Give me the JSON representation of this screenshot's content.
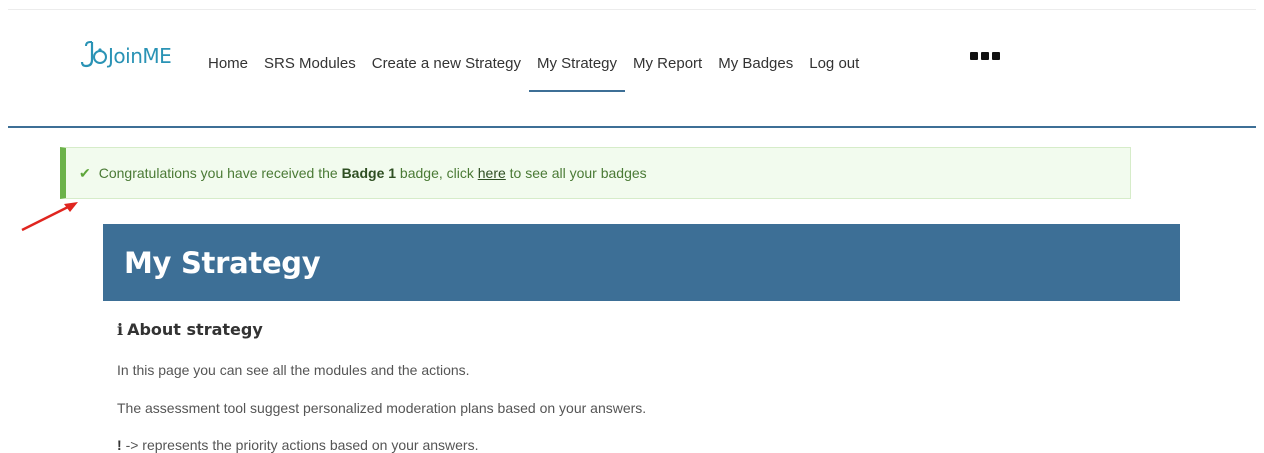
{
  "header": {
    "logo_text": "JoinME",
    "nav": [
      {
        "label": "Home"
      },
      {
        "label": "SRS Modules"
      },
      {
        "label": "Create a new Strategy"
      },
      {
        "label": "My Strategy",
        "active": true
      },
      {
        "label": "My Report"
      },
      {
        "label": "My Badges"
      },
      {
        "label": "Log out"
      }
    ],
    "more_icon": "more-dots-icon"
  },
  "alert": {
    "icon": "check-icon",
    "text_before": "Congratulations you have received the",
    "badge_name": "Badge 1",
    "text_middle": "badge, click",
    "link_text": "here",
    "text_after": "to see all your badges",
    "accent_color": "#6cb24a"
  },
  "banner": {
    "title": "My Strategy",
    "color": "#3d6f96"
  },
  "about": {
    "icon": "info-icon",
    "heading": "About strategy",
    "paragraphs": [
      "In this page you can see all the modules and the actions.",
      "The assessment tool suggest personalized moderation plans based on your answers."
    ],
    "priority_marker": "!",
    "priority_text": "-> represents the priority actions based on your answers."
  }
}
